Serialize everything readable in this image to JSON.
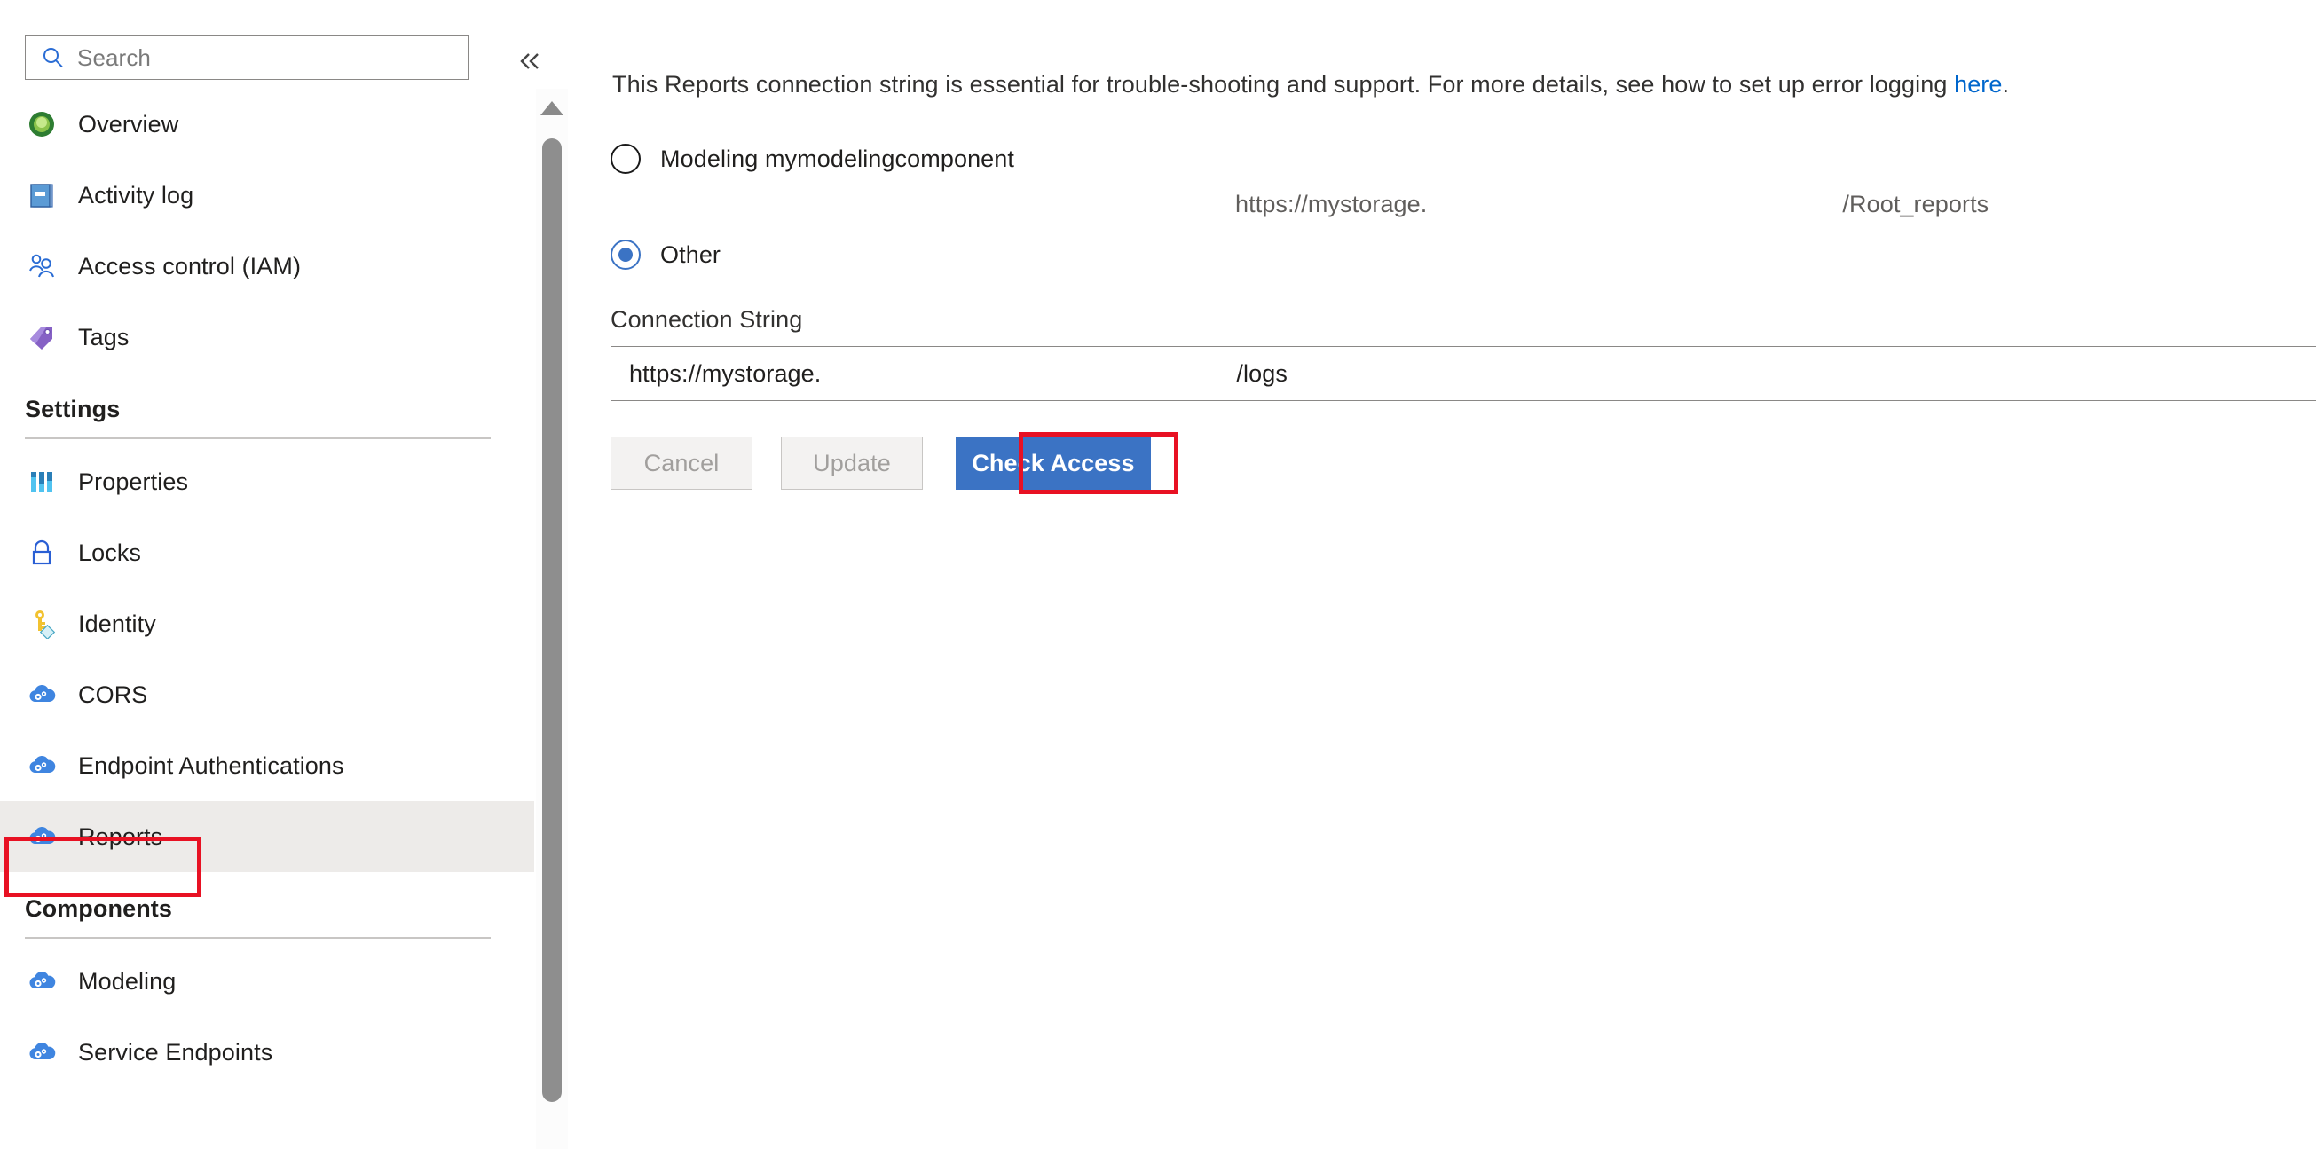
{
  "search": {
    "placeholder": "Search",
    "icon": "search-icon"
  },
  "collapse": {
    "icon": "double-chevron-left-icon",
    "label": "«"
  },
  "sidebar": {
    "items": [
      {
        "label": "Overview",
        "icon": "overview-icon",
        "selected": false
      },
      {
        "label": "Activity log",
        "icon": "activity-log-icon",
        "selected": false
      },
      {
        "label": "Access control (IAM)",
        "icon": "access-control-icon",
        "selected": false
      },
      {
        "label": "Tags",
        "icon": "tags-icon",
        "selected": false
      }
    ],
    "sections": [
      {
        "title": "Settings",
        "items": [
          {
            "label": "Properties",
            "icon": "properties-icon",
            "selected": false
          },
          {
            "label": "Locks",
            "icon": "lock-icon",
            "selected": false
          },
          {
            "label": "Identity",
            "icon": "key-icon",
            "selected": false
          },
          {
            "label": "CORS",
            "icon": "cloud-gear-icon",
            "selected": false
          },
          {
            "label": "Endpoint Authentications",
            "icon": "cloud-gear-icon",
            "selected": false
          },
          {
            "label": "Reports",
            "icon": "cloud-gear-icon",
            "selected": true
          }
        ]
      },
      {
        "title": "Components",
        "items": [
          {
            "label": "Modeling",
            "icon": "cloud-gear-icon",
            "selected": false
          },
          {
            "label": "Service Endpoints",
            "icon": "cloud-gear-icon",
            "selected": false
          }
        ]
      }
    ]
  },
  "main": {
    "description": {
      "text_before": "This Reports connection string is essential for trouble-shooting and support. For more details, see how to set up error logging ",
      "link_text": "here",
      "text_after": "."
    },
    "radio_group": {
      "options": [
        {
          "label": "Modeling mymodelingcomponent",
          "checked": false
        },
        {
          "label": "Other",
          "checked": true
        }
      ],
      "modeling_path_prefix": "https://mystorage.",
      "modeling_path_suffix": "/Root_reports"
    },
    "connection_string": {
      "label": "Connection String",
      "value_prefix": "https://mystorage.",
      "value_suffix": "/logs"
    },
    "buttons": {
      "cancel": "Cancel",
      "update": "Update",
      "check_access": "Check Access"
    }
  },
  "colors": {
    "accent": "#3b73c4",
    "link": "#0066cc",
    "highlight": "#e81123",
    "selected_bg": "#edebe9"
  }
}
